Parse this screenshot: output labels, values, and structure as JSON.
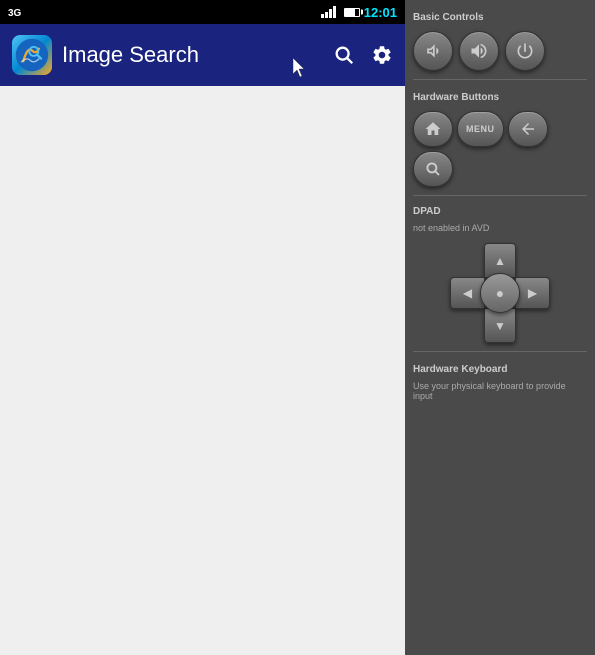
{
  "app": {
    "title": "Image Search",
    "status_bar": {
      "network": "3G",
      "time": "12:01"
    }
  },
  "controls": {
    "basic_controls_label": "Basic Controls",
    "hardware_buttons_label": "Hardware Buttons",
    "dpad_label": "DPAD",
    "dpad_sublabel": "not enabled in AVD",
    "keyboard_label": "Hardware Keyboard",
    "keyboard_sublabel": "Use your physical keyboard to provide input",
    "buttons": {
      "volume_down": "volume-down",
      "volume_up": "volume-up",
      "power": "power",
      "home": "home",
      "menu": "MENU",
      "back": "back",
      "search": "search"
    }
  }
}
